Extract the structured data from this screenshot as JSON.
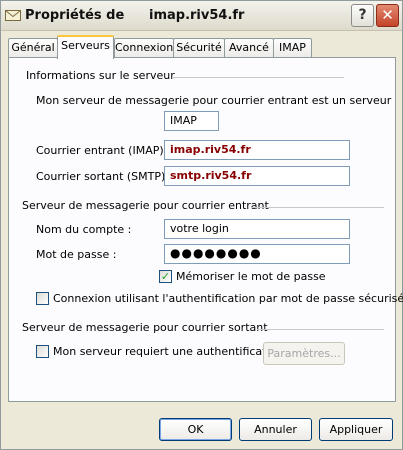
{
  "window": {
    "title_prefix": "Propriétés de",
    "title_host": "imap.riv54.fr",
    "icons": {
      "app": "envelope-icon",
      "help": "help-icon",
      "close": "close-icon"
    },
    "help_glyph": "?",
    "close_glyph": "✕"
  },
  "tabs": [
    {
      "label": "Général",
      "active": false
    },
    {
      "label": "Serveurs",
      "active": true
    },
    {
      "label": "Connexion",
      "active": false
    },
    {
      "label": "Sécurité",
      "active": false
    },
    {
      "label": "Avancé",
      "active": false
    },
    {
      "label": "IMAP",
      "active": false
    }
  ],
  "server_info": {
    "legend": "Informations sur le serveur",
    "incoming_type_label": "Mon serveur de messagerie pour courrier entrant est un serveur",
    "incoming_type_value": "IMAP",
    "incoming_label": "Courrier entrant (IMAP) :",
    "incoming_value": "imap.riv54.fr",
    "outgoing_label": "Courrier sortant (SMTP) :",
    "outgoing_value": "smtp.riv54.fr"
  },
  "incoming_server": {
    "legend": "Serveur de messagerie pour courrier entrant",
    "account_label": "Nom du compte :",
    "account_value": "votre login",
    "password_label": "Mot de passe :",
    "password_value": "●●●●●●●●",
    "remember_label": "Mémoriser le mot de passe",
    "remember_checked": true,
    "spa_label": "Connexion utilisant l'authentification par mot de passe sécurisé",
    "spa_checked": false
  },
  "outgoing_server": {
    "legend": "Serveur de messagerie pour courrier sortant",
    "auth_label": "Mon serveur requiert une authentification",
    "auth_checked": false,
    "settings_button": "Paramètres..."
  },
  "footer": {
    "ok": "OK",
    "cancel": "Annuler",
    "apply": "Appliquer"
  },
  "colors": {
    "window_bg": "#ece9d8",
    "panel_bg": "#fcfcfe",
    "field_border": "#7f9db9",
    "server_name_text": "#880000",
    "active_tab_accent": "#ffc83c",
    "checkmark": "#21a121"
  }
}
